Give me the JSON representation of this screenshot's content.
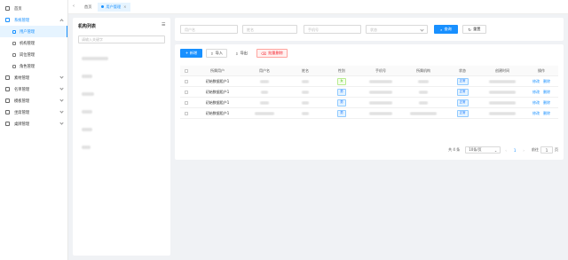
{
  "sidebar": {
    "items": [
      {
        "label": "首页"
      },
      {
        "label": "系统管理",
        "children": [
          {
            "label": "用户管理",
            "active": true
          },
          {
            "label": "机构管理"
          },
          {
            "label": "岗位管理"
          },
          {
            "label": "角色管理"
          }
        ]
      },
      {
        "label": "素材管理"
      },
      {
        "label": "名单管理"
      },
      {
        "label": "模板管理"
      },
      {
        "label": "坐席管理"
      },
      {
        "label": "桌牌管理"
      }
    ]
  },
  "tabs": [
    {
      "label": "首页"
    },
    {
      "label": "用户管理",
      "close": "×"
    }
  ],
  "org_panel": {
    "title": "机构列表",
    "search_placeholder": "请输入关键字"
  },
  "filters": {
    "username_placeholder": "用户名",
    "name_placeholder": "姓名",
    "phone_placeholder": "手机号",
    "status_placeholder": "状态",
    "search_button": "查询",
    "reset_button": "重置"
  },
  "toolbar": {
    "add_label": "+ 新增",
    "import_label": "导入",
    "export_label": "导出",
    "batch_delete_label": "批量删除"
  },
  "table": {
    "columns": [
      "所属用户",
      "用户名",
      "姓名",
      "性别",
      "手机号",
      "所属机构",
      "状态",
      "创建时间",
      "操作"
    ],
    "rows": [
      {
        "owner": "初始数据租户1",
        "gender": "女",
        "status": "正常",
        "edit": "修改",
        "delete": "删除"
      },
      {
        "owner": "初始数据租户1",
        "gender": "男",
        "status": "正常",
        "edit": "修改",
        "delete": "删除"
      },
      {
        "owner": "初始数据租户1",
        "gender": "男",
        "status": "正常",
        "edit": "修改",
        "delete": "删除"
      },
      {
        "owner": "初始数据租户1",
        "gender": "男",
        "status": "正常",
        "edit": "修改",
        "delete": "删除"
      }
    ]
  },
  "pagination": {
    "total": "共 4 条",
    "page_size": "10条/页",
    "current_page": "1",
    "goto_label": "前往",
    "goto_value": "1",
    "page_suffix": "页"
  },
  "colors": {
    "primary": "#1890ff",
    "danger": "#f5222d",
    "success": "#52c41a"
  }
}
